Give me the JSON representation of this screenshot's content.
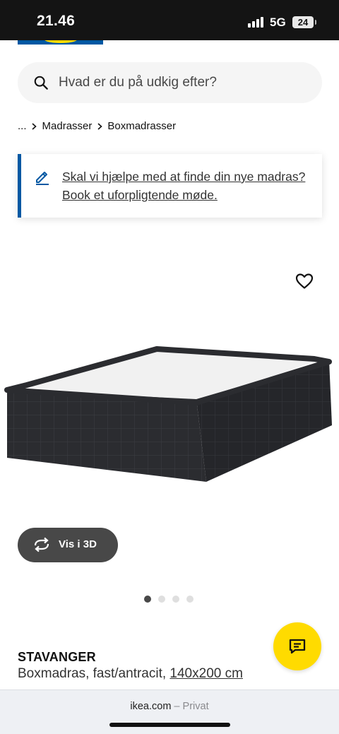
{
  "status_bar": {
    "time": "21.46",
    "network": "5G",
    "battery": "24"
  },
  "search": {
    "placeholder": "Hvad er du på udkig efter?"
  },
  "breadcrumb": {
    "ellipsis": "...",
    "items": [
      "Madrasser",
      "Boxmadrasser"
    ]
  },
  "help_card": {
    "line1": "Skal vi hjælpe med at finde din nye madras?",
    "line2": "Book et uforpligtende møde."
  },
  "image_controls": {
    "view3d_label": "Vis i 3D",
    "carousel_total": 4,
    "carousel_active": 1
  },
  "product": {
    "name": "STAVANGER",
    "description": "Boxmadras, fast/antracit, ",
    "size": "140x200 cm"
  },
  "url_bar": {
    "domain": "ikea.com",
    "separator": " – ",
    "mode": "Privat"
  },
  "icons": [
    "search-icon",
    "chevron-right-icon",
    "pencil-icon",
    "heart-icon",
    "rotate-3d-icon",
    "chat-icon"
  ],
  "colors": {
    "brand_blue": "#0058a3",
    "brand_yellow": "#ffdb00",
    "button_dark": "#484848"
  }
}
